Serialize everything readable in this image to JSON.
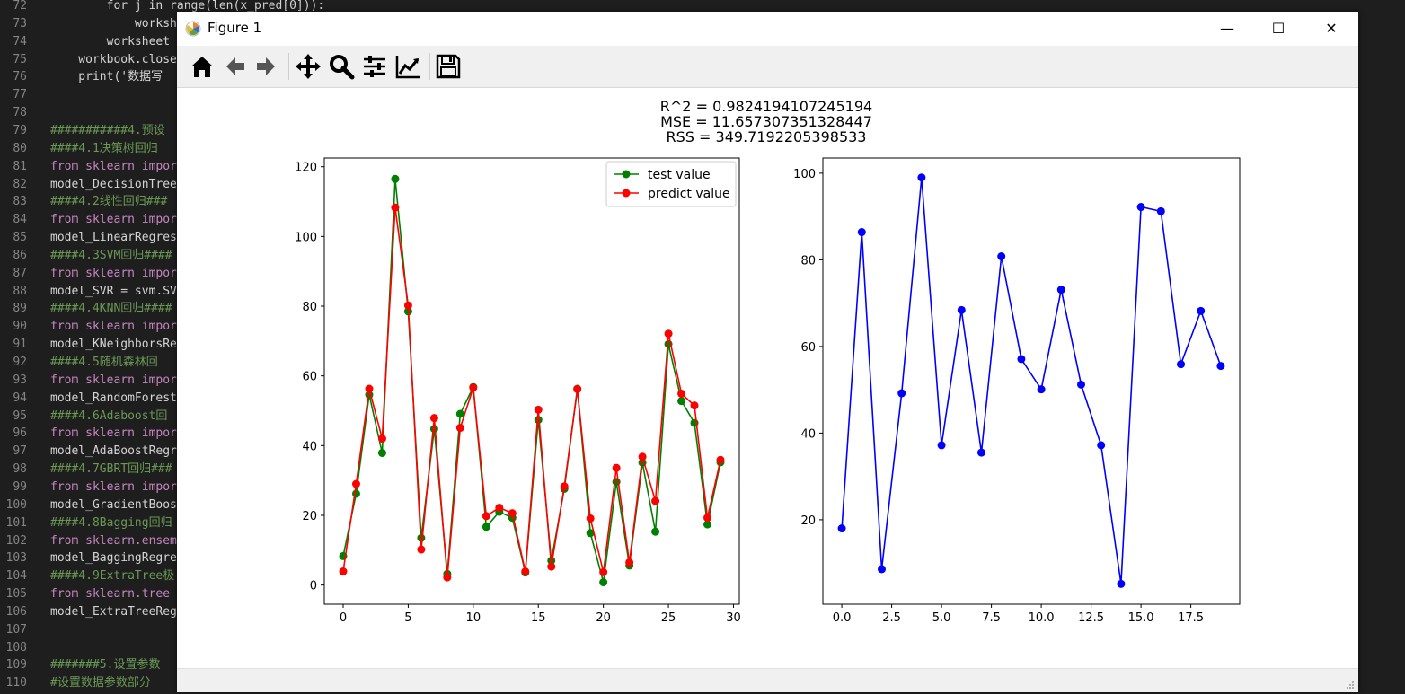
{
  "editor": {
    "lines": [
      {
        "n": "72",
        "text": "        for j in range(len(x_pred[0])):",
        "kind": "code"
      },
      {
        "n": "73",
        "text": "            worksh",
        "kind": "code"
      },
      {
        "n": "74",
        "text": "        worksheet",
        "kind": "code"
      },
      {
        "n": "75",
        "text": "    workbook.close",
        "kind": "code"
      },
      {
        "n": "76",
        "text": "    print('数据写",
        "kind": "code"
      },
      {
        "n": "77",
        "text": "",
        "kind": "code"
      },
      {
        "n": "78",
        "text": "",
        "kind": "code"
      },
      {
        "n": "79",
        "text": "###########4.预设",
        "kind": "comment"
      },
      {
        "n": "80",
        "text": "####4.1决策树回归",
        "kind": "comment"
      },
      {
        "n": "81",
        "text": "from sklearn impor",
        "kind": "kw"
      },
      {
        "n": "82",
        "text": "model_DecisionTree",
        "kind": "code"
      },
      {
        "n": "83",
        "text": "####4.2线性回归###",
        "kind": "comment"
      },
      {
        "n": "84",
        "text": "from sklearn impor",
        "kind": "kw"
      },
      {
        "n": "85",
        "text": "model_LinearRegres",
        "kind": "code"
      },
      {
        "n": "86",
        "text": "####4.3SVM回归####",
        "kind": "comment"
      },
      {
        "n": "87",
        "text": "from sklearn impor",
        "kind": "kw"
      },
      {
        "n": "88",
        "text": "model_SVR = svm.SV",
        "kind": "code"
      },
      {
        "n": "89",
        "text": "####4.4KNN回归####",
        "kind": "comment"
      },
      {
        "n": "90",
        "text": "from sklearn impor",
        "kind": "kw"
      },
      {
        "n": "91",
        "text": "model_KNeighborsRe",
        "kind": "code"
      },
      {
        "n": "92",
        "text": "####4.5随机森林回",
        "kind": "comment"
      },
      {
        "n": "93",
        "text": "from sklearn impor",
        "kind": "kw"
      },
      {
        "n": "94",
        "text": "model_RandomForest",
        "kind": "code"
      },
      {
        "n": "95",
        "text": "####4.6Adaboost回",
        "kind": "comment"
      },
      {
        "n": "96",
        "text": "from sklearn impor",
        "kind": "kw"
      },
      {
        "n": "97",
        "text": "model_AdaBoostRegr",
        "kind": "code"
      },
      {
        "n": "98",
        "text": "####4.7GBRT回归###",
        "kind": "comment"
      },
      {
        "n": "99",
        "text": "from sklearn impor",
        "kind": "kw"
      },
      {
        "n": "100",
        "text": "model_GradientBoos",
        "kind": "code"
      },
      {
        "n": "101",
        "text": "####4.8Bagging回归",
        "kind": "comment"
      },
      {
        "n": "102",
        "text": "from sklearn.ensem",
        "kind": "kw"
      },
      {
        "n": "103",
        "text": "model_BaggingRegre",
        "kind": "code"
      },
      {
        "n": "104",
        "text": "####4.9ExtraTree极",
        "kind": "comment"
      },
      {
        "n": "105",
        "text": "from sklearn.tree ",
        "kind": "kw"
      },
      {
        "n": "106",
        "text": "model_ExtraTreeReg",
        "kind": "code"
      },
      {
        "n": "107",
        "text": "",
        "kind": "code"
      },
      {
        "n": "108",
        "text": "",
        "kind": "code"
      },
      {
        "n": "109",
        "text": "#######5.设置参数",
        "kind": "comment"
      },
      {
        "n": "110",
        "text": "#设置数据参数部分",
        "kind": "comment"
      }
    ]
  },
  "window": {
    "title": "Figure 1",
    "minimize": "—",
    "maximize": "☐",
    "close": "✕"
  },
  "toolbar": {
    "items": [
      "home-icon",
      "back-icon",
      "forward-icon",
      "pan-icon",
      "zoom-icon",
      "configure-subplots-icon",
      "edit-axis-icon",
      "save-icon"
    ]
  },
  "figure": {
    "suptitle": [
      "R^2 = 0.9824194107245194",
      "MSE = 11.657307351328447",
      "RSS = 349.7192205398533"
    ]
  },
  "chart_data": [
    {
      "type": "line",
      "xlim": [
        -1.45,
        30.45
      ],
      "ylim": [
        -5.5,
        122.5
      ],
      "xticks": [
        0,
        5,
        10,
        15,
        20,
        25,
        30
      ],
      "yticks": [
        0,
        20,
        40,
        60,
        80,
        100,
        120
      ],
      "legend": "top-right",
      "x": [
        0,
        1,
        2,
        3,
        4,
        5,
        6,
        7,
        8,
        9,
        10,
        11,
        12,
        13,
        14,
        15,
        16,
        17,
        18,
        19,
        20,
        21,
        22,
        23,
        24,
        25,
        26,
        27,
        28,
        29
      ],
      "series": [
        {
          "name": "test value",
          "color": "#008000",
          "values": [
            8.3,
            26.2,
            54.6,
            37.9,
            116.5,
            78.5,
            13.5,
            44.8,
            3.2,
            49.1,
            56.8,
            16.7,
            21.0,
            19.3,
            3.6,
            47.4,
            7.0,
            27.6,
            56.3,
            14.9,
            0.8,
            29.6,
            5.6,
            35.1,
            15.3,
            69.1,
            52.8,
            46.5,
            17.4,
            35.2
          ]
        },
        {
          "name": "predict value",
          "color": "#ff0000",
          "values": [
            3.9,
            29.0,
            56.3,
            42.0,
            108.3,
            80.2,
            10.2,
            47.9,
            2.2,
            45.1,
            56.6,
            19.8,
            22.2,
            20.6,
            3.9,
            50.3,
            5.3,
            28.3,
            56.2,
            19.1,
            3.7,
            33.6,
            6.5,
            36.8,
            24.1,
            72.1,
            54.9,
            51.5,
            19.3,
            35.9
          ]
        }
      ]
    },
    {
      "type": "line",
      "xlim": [
        -0.95,
        19.95
      ],
      "ylim": [
        0.5,
        103.5
      ],
      "xticks": [
        0.0,
        2.5,
        5.0,
        7.5,
        10.0,
        12.5,
        15.0,
        17.5
      ],
      "xtick_labels": [
        "0.0",
        "2.5",
        "5.0",
        "7.5",
        "10.0",
        "12.5",
        "15.0",
        "17.5"
      ],
      "yticks": [
        20,
        40,
        60,
        80,
        100
      ],
      "x": [
        0,
        1,
        2,
        3,
        4,
        5,
        6,
        7,
        8,
        9,
        10,
        11,
        12,
        13,
        14,
        15,
        16,
        17,
        18,
        19
      ],
      "series": [
        {
          "color": "#0000ff",
          "values": [
            18.0,
            86.4,
            8.6,
            49.2,
            99.0,
            37.2,
            68.4,
            35.5,
            80.8,
            57.1,
            50.1,
            73.1,
            51.2,
            37.2,
            5.2,
            92.2,
            91.2,
            55.9,
            68.2,
            55.5
          ]
        }
      ]
    }
  ]
}
